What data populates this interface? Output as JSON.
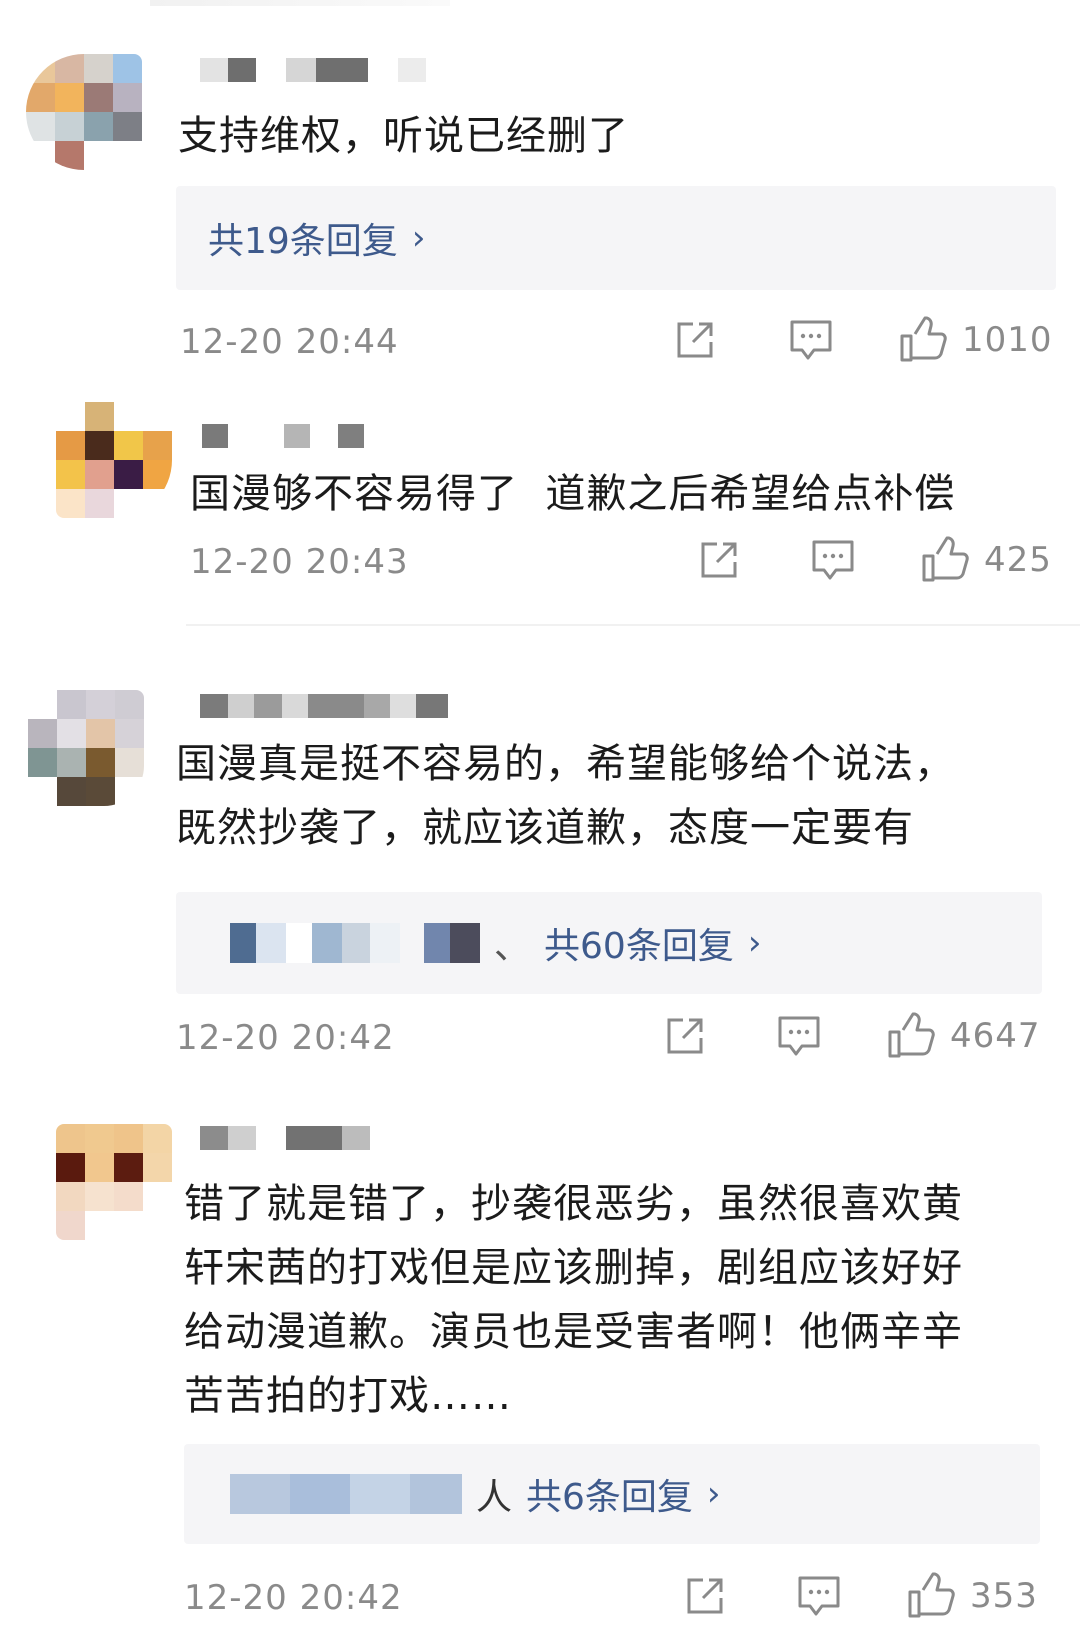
{
  "comments": [
    {
      "text": "支持维权，听说已经删了",
      "reply_label": "共19条回复",
      "timestamp": "12-20 20:44",
      "likes": "1010"
    },
    {
      "text": "国漫够不容易得了  道歉之后希望给点补偿",
      "timestamp": "12-20 20:43",
      "likes": "425"
    },
    {
      "text": "国漫真是挺不容易的，希望能够给个说法，\n既然抄袭了，就应该道歉，态度一定要有",
      "reply_separator": "、",
      "reply_label": "共60条回复",
      "timestamp": "12-20 20:42",
      "likes": "4647"
    },
    {
      "text": "错了就是错了，抄袭很恶劣，虽然很喜欢黄\n轩宋茜的打戏但是应该删掉，剧组应该好好\n给动漫道歉。演员也是受害者啊！他俩辛辛\n苦苦拍的打戏……",
      "reply_prefix": "人",
      "reply_label": "共6条回复",
      "timestamp": "12-20 20:42",
      "likes": "353"
    }
  ],
  "icons": {
    "repost": "share-box-icon",
    "comment": "comment-bubble-icon",
    "like": "thumbs-up-icon",
    "chevron": "chevron-right-icon"
  },
  "colors": {
    "reply_link": "#3e5a8c",
    "meta": "#8a8a8a",
    "reply_bg": "#f5f5f7"
  }
}
